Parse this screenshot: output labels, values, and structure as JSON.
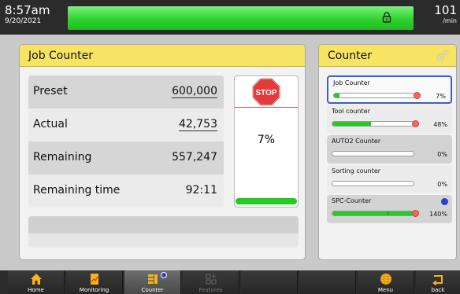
{
  "status": {
    "time": "8:57am",
    "date": "9/20/2021",
    "rate_value": "101",
    "rate_unit": "/min",
    "bar_color": "#2fd32f",
    "lock_icon": "padlock-icon"
  },
  "job_counter": {
    "title": "Job Counter",
    "rows": [
      {
        "label": "Preset",
        "value": "600,000"
      },
      {
        "label": "Actual",
        "value": "42,753"
      },
      {
        "label": "Remaining",
        "value": "557,247"
      },
      {
        "label": "Remaining time",
        "value": "92:11"
      }
    ],
    "stop_label": "STOP",
    "percent": "7%",
    "progress_fraction": 0.07
  },
  "counter_panel": {
    "title": "Counter",
    "gear_icon": "gears-icon",
    "items": [
      {
        "name": "Job Counter",
        "value": "7%",
        "fill": 0.07
      },
      {
        "name": "Tool counter",
        "value": "48%",
        "fill": 0.48
      },
      {
        "name": "AUTO2 Counter",
        "value": "0%",
        "fill": 0.0
      },
      {
        "name": "Sorting counter",
        "value": "0%",
        "fill": 0.0
      },
      {
        "name": "SPC-Counter",
        "value": "140%",
        "fill": 1.0
      }
    ]
  },
  "nav": {
    "home": "Home",
    "monitoring": "Monitoring",
    "counter": "Counter",
    "features": "Features",
    "menu": "Menu",
    "back": "back"
  }
}
